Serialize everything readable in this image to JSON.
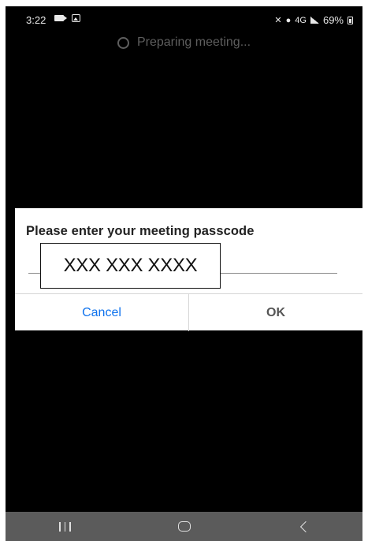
{
  "status_bar": {
    "time": "3:22",
    "network": "4G",
    "battery": "69%"
  },
  "preparing": {
    "text": "Preparing meeting..."
  },
  "dialog": {
    "title": "Please enter your meeting passcode",
    "passcode_value": "XXX XXX XXXX",
    "cancel_label": "Cancel",
    "ok_label": "OK"
  },
  "colors": {
    "accent": "#0e72ed",
    "background": "#000000",
    "nav_bar": "#5b5b5b"
  },
  "icons": [
    "video-camera-icon",
    "gallery-icon",
    "mute-icon",
    "location-icon",
    "signal-icon",
    "battery-icon",
    "spinner-icon",
    "recents-icon",
    "home-icon",
    "back-icon"
  ]
}
